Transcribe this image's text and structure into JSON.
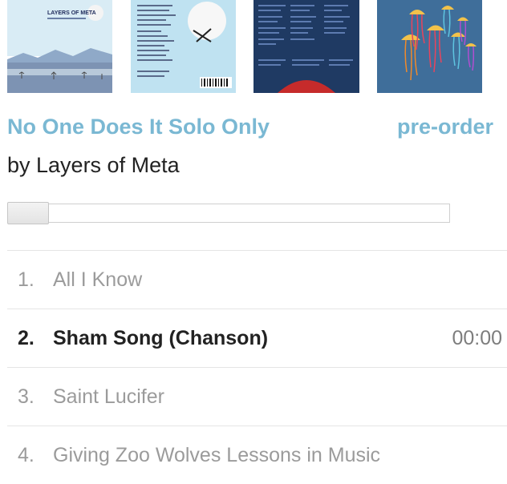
{
  "album": {
    "title": "No One Does It Solo Only",
    "artist": "by Layers of Meta",
    "preorder_label": "pre-order"
  },
  "thumbnails": [
    {
      "name": "cover-front",
      "text": "LAYERS OF META"
    },
    {
      "name": "cover-back"
    },
    {
      "name": "inner-sleeve"
    },
    {
      "name": "jellyfish-art"
    }
  ],
  "player": {
    "progress": 0
  },
  "tracks": [
    {
      "num": "1.",
      "title": "All I Know",
      "time": ""
    },
    {
      "num": "2.",
      "title": "Sham Song (Chanson)",
      "time": "00:00"
    },
    {
      "num": "3.",
      "title": "Saint Lucifer",
      "time": ""
    },
    {
      "num": "4.",
      "title": "Giving Zoo Wolves Lessons in Music",
      "time": ""
    }
  ],
  "colors": {
    "accent": "#7ab8d3",
    "text": "#222222",
    "muted": "#9b9b9b"
  }
}
